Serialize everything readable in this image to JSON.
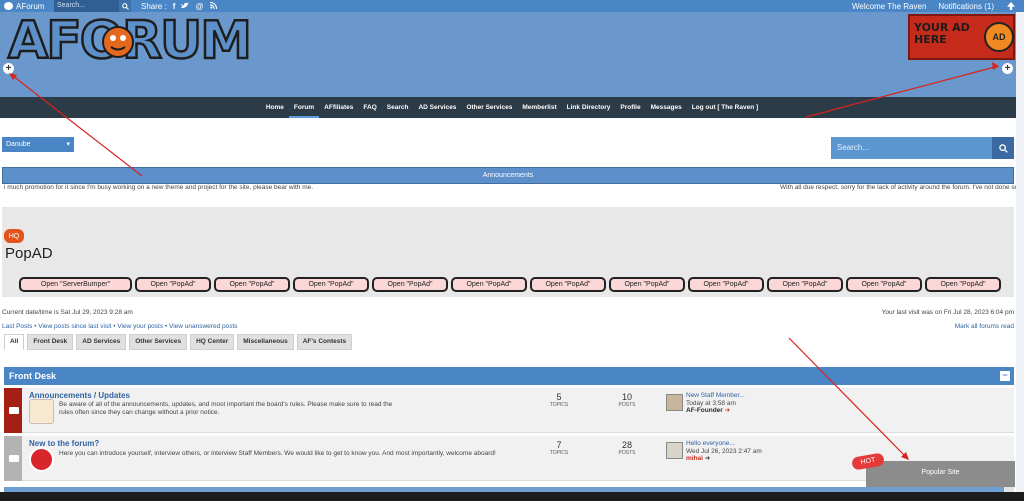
{
  "topbar": {
    "app_name": "AForum",
    "search_placeholder": "Search...",
    "share_label": "Share :",
    "share_icons": [
      "facebook-icon",
      "twitter-icon",
      "at-icon",
      "rss-icon"
    ],
    "welcome": "Welcome The Raven",
    "notifications": "Notifications",
    "notifications_count": "(1)"
  },
  "header": {
    "logo_text": "AFORUM",
    "ad_text_line1": "YOUR AD",
    "ad_text_line2": "HERE",
    "ad_face_text": "AD"
  },
  "nav": {
    "items": [
      "Home",
      "Forum",
      "AFfiliates",
      "FAQ",
      "Search",
      "AD Services",
      "Other Services",
      "Memberlist",
      "Link Directory",
      "Profile",
      "Messages",
      "Log out [ The Raven ]"
    ],
    "active_index": 1
  },
  "theme_select": "Danube",
  "search2_placeholder": "Search...",
  "announcements": {
    "label": "Announcements",
    "ticker_left": "i much promotion for it since I'm busy working on a new theme and project for the site, please bear with me.",
    "ticker_right": "With all due respect, sorry for the lack of activity around the forum. I've not done sc"
  },
  "popad": {
    "badge": "HQ",
    "title": "PopAD",
    "buttons": [
      "Open \"ServerBumper\"",
      "Open \"PopAd\"",
      "Open \"PopAd\"",
      "Open \"PopAd\"",
      "Open \"PopAd\"",
      "Open \"PopAd\"",
      "Open \"PopAd\"",
      "Open \"PopAd\"",
      "Open \"PopAd\"",
      "Open \"PopAd\"",
      "Open \"PopAd\"",
      "Open \"PopAd\""
    ]
  },
  "info": {
    "current_time": "Current date/time is Sat Jul 29, 2023 9:28 am",
    "last_visit": "Your last visit was on Fri Jul 28, 2023 6:04 pm",
    "links": "Last Posts • View posts since last visit • View your posts • View unanswered posts",
    "mark_read": "Mark all forums read"
  },
  "tabs": [
    "All",
    "Front Desk",
    "AD Services",
    "Other Services",
    "HQ Center",
    "Miscellaneous",
    "AF's Contests"
  ],
  "category": {
    "title": "Front Desk",
    "minimize": "−"
  },
  "forums": [
    {
      "name": "Announcements / Updates",
      "desc": "Be aware of all of the announcements, updates, and most important the board's rules. Please make sure to read the rules often since they can change without a prior notice.",
      "topics": "5",
      "posts": "10",
      "topics_label": "TOPICS",
      "posts_label": "POSTS",
      "last_title": "New Staff Member...",
      "last_time": "Today at 3:58 am",
      "last_user": "AF-Founder"
    },
    {
      "name": "New to the forum?",
      "desc": "Here you can introduce yourself, interview others, or interview Staff Members. We would like to get to know you. And most importantly, welcome aboard!",
      "topics": "7",
      "posts": "28",
      "topics_label": "TOPICS",
      "posts_label": "POSTS",
      "last_title": "Hello everyone...",
      "last_time": "Wed Jul 26, 2023 2:47 am",
      "last_user": "mihai"
    }
  ],
  "popular": {
    "hot": "HOT",
    "label": "Popular Site"
  },
  "colors": {
    "topbar": "#4a86c6",
    "header": "#6a98cc",
    "nav": "#2c3b48",
    "accent_red": "#a52014",
    "annotation_arrow": "#d9231b"
  }
}
